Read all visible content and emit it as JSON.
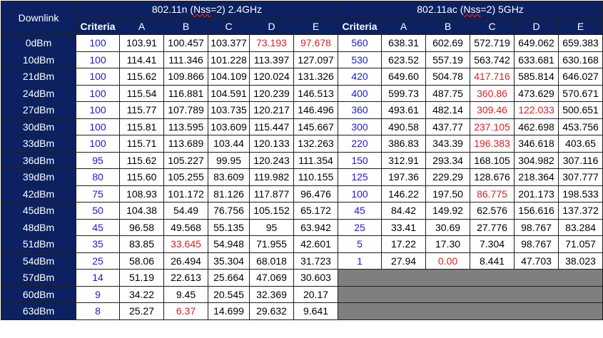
{
  "header": {
    "downlink_label": "Downlink",
    "group_24": {
      "prefix": "802.11n (",
      "nss": "Nss",
      "suffix": "=2) 2.4GHz"
    },
    "group_5": {
      "prefix": "802.11ac (",
      "nss": "Nss",
      "suffix": "=2) 5GHz"
    },
    "criteria_label": "Criteria",
    "columns": [
      "A",
      "B",
      "C",
      "D",
      "E"
    ]
  },
  "colors": {
    "header_bg": "#0c2161",
    "criteria_text": "#1a1ad6",
    "fail_text": "#e01f1f",
    "empty_fill": "#7f7f7f"
  },
  "rows": [
    {
      "label": "0dBm",
      "n24": {
        "criteria": "100",
        "values": [
          "103.91",
          "100.457",
          "103.377",
          "73.193",
          "97.678"
        ],
        "red": [
          false,
          false,
          false,
          true,
          true
        ]
      },
      "ac5": {
        "criteria": "560",
        "values": [
          "638.31",
          "602.69",
          "572.719",
          "649.062",
          "659.383"
        ],
        "red": [
          false,
          false,
          false,
          false,
          false
        ]
      }
    },
    {
      "label": "10dBm",
      "n24": {
        "criteria": "100",
        "values": [
          "114.41",
          "111.346",
          "101.228",
          "113.397",
          "127.097"
        ],
        "red": [
          false,
          false,
          false,
          false,
          false
        ]
      },
      "ac5": {
        "criteria": "530",
        "values": [
          "623.52",
          "557.19",
          "563.742",
          "633.681",
          "630.168"
        ],
        "red": [
          false,
          false,
          false,
          false,
          false
        ]
      }
    },
    {
      "label": "21dBm",
      "n24": {
        "criteria": "100",
        "values": [
          "115.62",
          "109.866",
          "104.109",
          "120.024",
          "131.326"
        ],
        "red": [
          false,
          false,
          false,
          false,
          false
        ]
      },
      "ac5": {
        "criteria": "420",
        "values": [
          "649.60",
          "504.78",
          "417.716",
          "585.814",
          "646.027"
        ],
        "red": [
          false,
          false,
          true,
          false,
          false
        ]
      }
    },
    {
      "label": "24dBm",
      "n24": {
        "criteria": "100",
        "values": [
          "115.54",
          "116.881",
          "104.591",
          "120.239",
          "146.513"
        ],
        "red": [
          false,
          false,
          false,
          false,
          false
        ]
      },
      "ac5": {
        "criteria": "400",
        "values": [
          "599.73",
          "487.75",
          "360.86",
          "473.629",
          "570.671"
        ],
        "red": [
          false,
          false,
          true,
          false,
          false
        ]
      }
    },
    {
      "label": "27dBm",
      "n24": {
        "criteria": "100",
        "values": [
          "115.77",
          "107.789",
          "103.735",
          "120.217",
          "146.496"
        ],
        "red": [
          false,
          false,
          false,
          false,
          false
        ]
      },
      "ac5": {
        "criteria": "360",
        "values": [
          "493.61",
          "482.14",
          "309.46",
          "122.033",
          "500.651"
        ],
        "red": [
          false,
          false,
          true,
          true,
          false
        ]
      }
    },
    {
      "label": "30dBm",
      "n24": {
        "criteria": "100",
        "values": [
          "115.81",
          "113.595",
          "103.609",
          "115.447",
          "145.667"
        ],
        "red": [
          false,
          false,
          false,
          false,
          false
        ]
      },
      "ac5": {
        "criteria": "300",
        "values": [
          "490.58",
          "437.77",
          "237.105",
          "462.698",
          "453.756"
        ],
        "red": [
          false,
          false,
          true,
          false,
          false
        ]
      }
    },
    {
      "label": "33dBm",
      "n24": {
        "criteria": "100",
        "values": [
          "115.71",
          "113.689",
          "103.44",
          "120.133",
          "132.263"
        ],
        "red": [
          false,
          false,
          false,
          false,
          false
        ]
      },
      "ac5": {
        "criteria": "220",
        "values": [
          "386.83",
          "343.39",
          "196.383",
          "346.618",
          "403.65"
        ],
        "red": [
          false,
          false,
          true,
          false,
          false
        ]
      }
    },
    {
      "label": "36dBm",
      "n24": {
        "criteria": "95",
        "values": [
          "115.62",
          "105.227",
          "99.95",
          "120.243",
          "111.354"
        ],
        "red": [
          false,
          false,
          false,
          false,
          false
        ]
      },
      "ac5": {
        "criteria": "150",
        "values": [
          "312.91",
          "293.34",
          "168.105",
          "304.982",
          "307.116"
        ],
        "red": [
          false,
          false,
          false,
          false,
          false
        ]
      }
    },
    {
      "label": "39dBm",
      "n24": {
        "criteria": "80",
        "values": [
          "115.60",
          "105.255",
          "83.609",
          "119.982",
          "110.155"
        ],
        "red": [
          false,
          false,
          false,
          false,
          false
        ]
      },
      "ac5": {
        "criteria": "125",
        "values": [
          "197.36",
          "229.29",
          "128.676",
          "218.364",
          "307.777"
        ],
        "red": [
          false,
          false,
          false,
          false,
          false
        ]
      }
    },
    {
      "label": "42dBm",
      "n24": {
        "criteria": "75",
        "values": [
          "108.93",
          "101.172",
          "81.126",
          "117.877",
          "96.476"
        ],
        "red": [
          false,
          false,
          false,
          false,
          false
        ]
      },
      "ac5": {
        "criteria": "100",
        "values": [
          "146.22",
          "197.50",
          "86.775",
          "201.173",
          "198.533"
        ],
        "red": [
          false,
          false,
          true,
          false,
          false
        ]
      }
    },
    {
      "label": "45dBm",
      "n24": {
        "criteria": "50",
        "values": [
          "104.38",
          "54.49",
          "76.756",
          "105.152",
          "65.172"
        ],
        "red": [
          false,
          false,
          false,
          false,
          false
        ]
      },
      "ac5": {
        "criteria": "45",
        "values": [
          "84.42",
          "149.92",
          "62.576",
          "156.616",
          "137.372"
        ],
        "red": [
          false,
          false,
          false,
          false,
          false
        ]
      }
    },
    {
      "label": "48dBm",
      "n24": {
        "criteria": "45",
        "values": [
          "96.58",
          "49.568",
          "55.135",
          "95",
          "63.942"
        ],
        "red": [
          false,
          false,
          false,
          false,
          false
        ]
      },
      "ac5": {
        "criteria": "25",
        "values": [
          "33.41",
          "30.69",
          "27.776",
          "98.767",
          "83.284"
        ],
        "red": [
          false,
          false,
          false,
          false,
          false
        ]
      }
    },
    {
      "label": "51dBm",
      "n24": {
        "criteria": "35",
        "values": [
          "83.85",
          "33.645",
          "54.948",
          "71.955",
          "42.601"
        ],
        "red": [
          false,
          true,
          false,
          false,
          false
        ]
      },
      "ac5": {
        "criteria": "5",
        "values": [
          "17.22",
          "17.30",
          "7.304",
          "98.767",
          "71.057"
        ],
        "red": [
          false,
          false,
          false,
          false,
          false
        ]
      }
    },
    {
      "label": "54dBm",
      "n24": {
        "criteria": "25",
        "values": [
          "58.06",
          "26.494",
          "35.304",
          "68.018",
          "31.723"
        ],
        "red": [
          false,
          false,
          false,
          false,
          false
        ]
      },
      "ac5": {
        "criteria": "1",
        "values": [
          "27.94",
          "0.00",
          "8.441",
          "47.703",
          "38.023"
        ],
        "red": [
          false,
          true,
          false,
          false,
          false
        ]
      }
    },
    {
      "label": "57dBm",
      "n24": {
        "criteria": "14",
        "values": [
          "51.19",
          "22.613",
          "25.664",
          "47.069",
          "30.603"
        ],
        "red": [
          false,
          false,
          false,
          false,
          false
        ]
      },
      "ac5": null
    },
    {
      "label": "60dBm",
      "n24": {
        "criteria": "9",
        "values": [
          "34.22",
          "9.45",
          "20.545",
          "32.369",
          "20.17"
        ],
        "red": [
          false,
          false,
          false,
          false,
          false
        ]
      },
      "ac5": null
    },
    {
      "label": "63dBm",
      "n24": {
        "criteria": "8",
        "values": [
          "25.27",
          "6.37",
          "14.699",
          "29.632",
          "9.641"
        ],
        "red": [
          false,
          true,
          false,
          false,
          false
        ]
      },
      "ac5": null
    }
  ]
}
